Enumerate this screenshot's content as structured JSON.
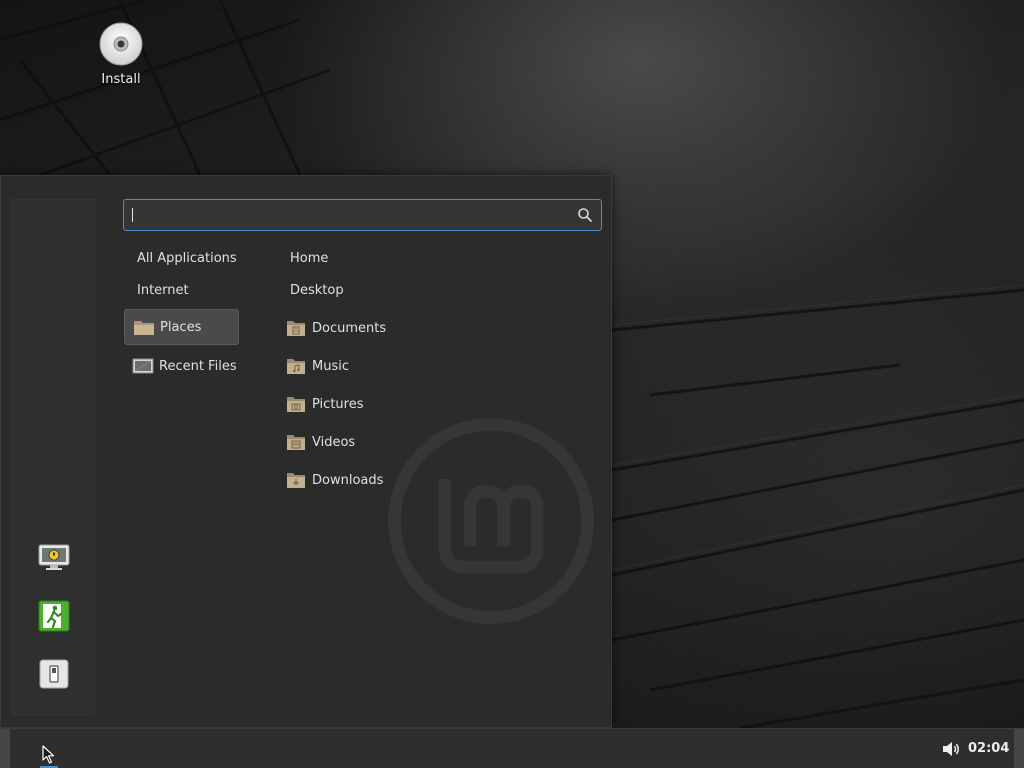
{
  "desktop": {
    "icons": [
      {
        "label": "Install",
        "icon": "disc-icon"
      }
    ]
  },
  "menu": {
    "search": {
      "value": "",
      "placeholder": "",
      "icon": "search-icon"
    },
    "favorites": [
      {
        "name": "lock-screen",
        "icon": "lock-screen-icon"
      },
      {
        "name": "logout",
        "icon": "logout-icon"
      },
      {
        "name": "shutdown",
        "icon": "power-icon"
      }
    ],
    "categories": [
      {
        "label": "All Applications"
      },
      {
        "label": "Internet"
      },
      {
        "label": "Places",
        "icon": "folder-icon",
        "active": true
      },
      {
        "label": "Recent Files",
        "icon": "recent-files-icon"
      }
    ],
    "places": [
      {
        "label": "Home"
      },
      {
        "label": "Desktop"
      },
      {
        "label": "Documents",
        "icon": "documents-folder-icon"
      },
      {
        "label": "Music",
        "icon": "music-folder-icon"
      },
      {
        "label": "Pictures",
        "icon": "pictures-folder-icon"
      },
      {
        "label": "Videos",
        "icon": "videos-folder-icon"
      },
      {
        "label": "Downloads",
        "icon": "downloads-folder-icon"
      }
    ]
  },
  "panel": {
    "menu_button_icon": "mint-menu-icon",
    "volume_icon": "volume-icon",
    "clock": "02:04"
  },
  "colors": {
    "accent": "#4a8fc9",
    "menu_bg": "#2b2b2b",
    "panel_bg": "#2e2e2e",
    "active_item": "#4a4a4a",
    "folder": "#b8a382"
  }
}
